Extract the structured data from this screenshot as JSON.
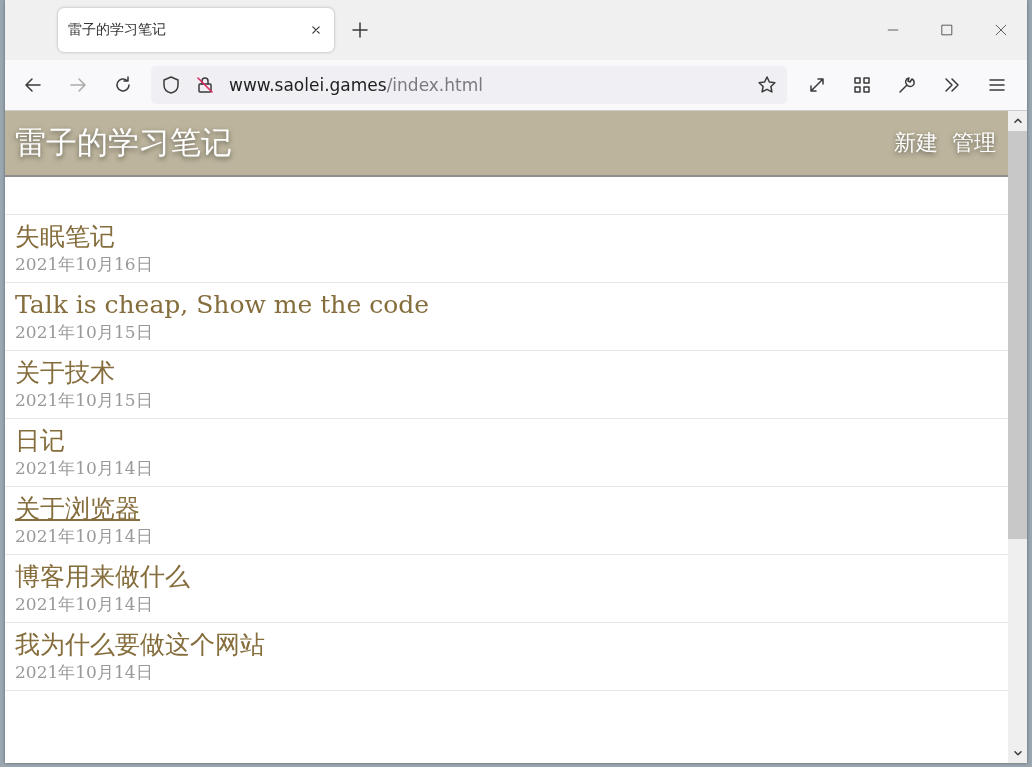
{
  "browser": {
    "tab": {
      "title": "雷子的学习笔记",
      "selected": true
    },
    "address": {
      "host": "www.saolei.games",
      "path": "/index.html"
    }
  },
  "site": {
    "title": "雷子的学习笔记",
    "nav": [
      "新建",
      "管理"
    ]
  },
  "posts": [
    {
      "title": "失眠笔记",
      "date": "2021年10月16日",
      "hovered": false
    },
    {
      "title": "Talk is cheap, Show me the code",
      "date": "2021年10月15日",
      "hovered": false
    },
    {
      "title": "关于技术",
      "date": "2021年10月15日",
      "hovered": false
    },
    {
      "title": "日记",
      "date": "2021年10月14日",
      "hovered": false
    },
    {
      "title": "关于浏览器",
      "date": "2021年10月14日",
      "hovered": true
    },
    {
      "title": "博客用来做什么",
      "date": "2021年10月14日",
      "hovered": false
    },
    {
      "title": "我为什么要做这个网站",
      "date": "2021年10月14日",
      "hovered": false
    }
  ]
}
